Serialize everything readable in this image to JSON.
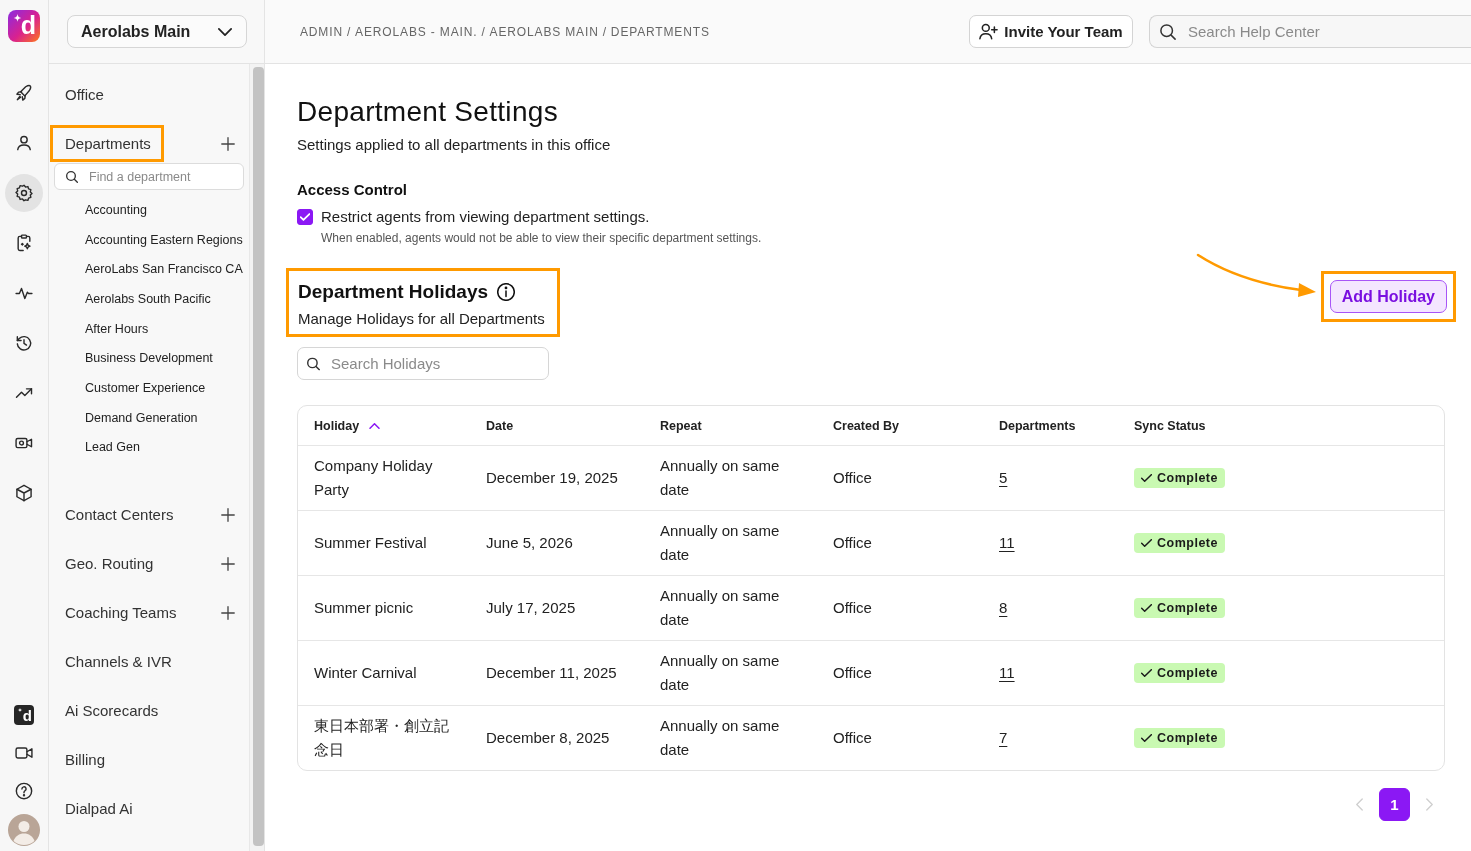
{
  "rail": {
    "logo": "d",
    "items": [
      {
        "selected": false
      },
      {
        "selected": false
      },
      {
        "selected": true
      },
      {
        "selected": false
      },
      {
        "selected": false
      },
      {
        "selected": false
      },
      {
        "selected": false
      },
      {
        "selected": false
      },
      {
        "selected": false
      }
    ],
    "bottom_logo": "d"
  },
  "sidebar": {
    "office_selector": {
      "value": "Aerolabs Main"
    },
    "sections": [
      {
        "label": "Office",
        "addable": false,
        "highlighted": false
      },
      {
        "label": "Departments",
        "addable": true,
        "highlighted": true,
        "search": {
          "placeholder": "Find a department"
        },
        "children": [
          {
            "label": "Accounting"
          },
          {
            "label": "Accounting Eastern Regions"
          },
          {
            "label": "AeroLabs San Francisco CA"
          },
          {
            "label": "Aerolabs South Pacific"
          },
          {
            "label": "After Hours"
          },
          {
            "label": "Business Development"
          },
          {
            "label": "Customer Experience"
          },
          {
            "label": "Demand Generation"
          },
          {
            "label": "Lead Gen"
          }
        ]
      },
      {
        "label": "Contact Centers",
        "addable": true,
        "highlighted": false
      },
      {
        "label": "Geo. Routing",
        "addable": true,
        "highlighted": false
      },
      {
        "label": "Coaching Teams",
        "addable": true,
        "highlighted": false
      },
      {
        "label": "Channels & IVR",
        "addable": false,
        "highlighted": false
      },
      {
        "label": "Ai Scorecards",
        "addable": false,
        "highlighted": false
      },
      {
        "label": "Billing",
        "addable": false,
        "highlighted": false
      },
      {
        "label": "Dialpad Ai",
        "addable": false,
        "highlighted": false
      }
    ]
  },
  "topbar": {
    "breadcrumb": {
      "separator": "/",
      "items": [
        "ADMIN",
        "AEROLABS - MAIN.",
        "AEROLABS MAIN",
        "DEPARTMENTS"
      ]
    },
    "invite_button": {
      "label": "Invite Your Team"
    },
    "help_search": {
      "placeholder": "Search Help Center"
    }
  },
  "page": {
    "title": "Department Settings",
    "subtitle": "Settings applied to all departments in this office",
    "access_control": {
      "heading": "Access Control",
      "option": {
        "label": "Restrict agents from viewing department settings.",
        "checked": true,
        "help": "When enabled, agents would not be able to view their specific department settings."
      }
    },
    "holidays": {
      "title": "Department Holidays",
      "subtitle": "Manage Holidays for all Departments",
      "highlighted": true,
      "search": {
        "placeholder": "Search Holidays"
      },
      "add_button": {
        "label": "Add Holiday",
        "highlighted": true,
        "arrow": true
      }
    }
  },
  "table": {
    "columns": [
      {
        "label": "Holiday",
        "sorted_ascending": true
      },
      {
        "label": "Date"
      },
      {
        "label": "Repeat"
      },
      {
        "label": "Created By"
      },
      {
        "label": "Departments"
      },
      {
        "label": "Sync Status"
      }
    ],
    "rows": [
      {
        "holiday": "Company Holiday Party",
        "date": "December 19, 2025",
        "repeat": "Annually on same date",
        "created_by": "Office",
        "departments": "5",
        "sync_status": "Complete"
      },
      {
        "holiday": "Summer Festival",
        "date": "June 5, 2026",
        "repeat": "Annually on same date",
        "created_by": "Office",
        "departments": "11",
        "sync_status": "Complete"
      },
      {
        "holiday": "Summer picnic",
        "date": "July 17, 2025",
        "repeat": "Annually on same date",
        "created_by": "Office",
        "departments": "8",
        "sync_status": "Complete"
      },
      {
        "holiday": "Winter Carnival",
        "date": "December 11, 2025",
        "repeat": "Annually on same date",
        "created_by": "Office",
        "departments": "11",
        "sync_status": "Complete"
      },
      {
        "holiday": "東日本部署・創立記念日",
        "date": "December 8, 2025",
        "repeat": "Annually on same date",
        "created_by": "Office",
        "departments": "7",
        "sync_status": "Complete"
      }
    ]
  },
  "pagination": {
    "prev_disabled": true,
    "next_disabled": true,
    "pages": [
      {
        "label": "1",
        "selected": true
      }
    ]
  }
}
